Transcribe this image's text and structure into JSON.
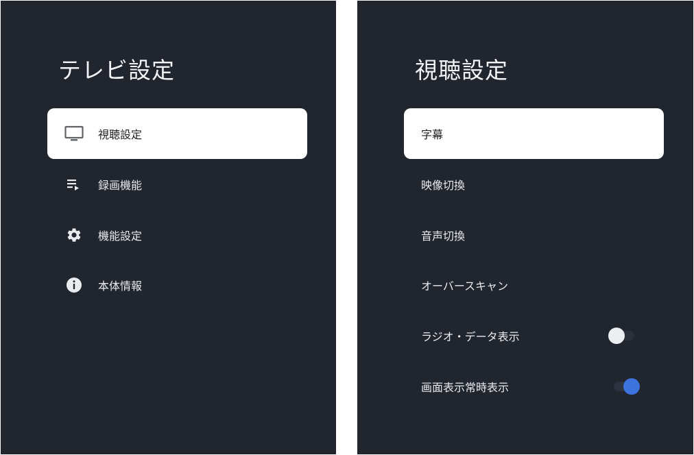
{
  "left_panel": {
    "title": "テレビ設定",
    "items": [
      {
        "label": "視聴設定",
        "icon": "tv-icon",
        "selected": true
      },
      {
        "label": "録画機能",
        "icon": "playlist-play-icon",
        "selected": false
      },
      {
        "label": "機能設定",
        "icon": "gear-icon",
        "selected": false
      },
      {
        "label": "本体情報",
        "icon": "info-icon",
        "selected": false
      }
    ]
  },
  "right_panel": {
    "title": "視聴設定",
    "items": [
      {
        "label": "字幕",
        "selected": true
      },
      {
        "label": "映像切換"
      },
      {
        "label": "音声切換"
      },
      {
        "label": "オーバースキャン"
      },
      {
        "label": "ラジオ・データ表示",
        "toggle": "off"
      },
      {
        "label": "画面表示常時表示",
        "toggle": "on"
      }
    ]
  },
  "colors": {
    "panel_bg": "#21252e",
    "selected_bg": "#ffffff",
    "toggle_on": "#3d73dc",
    "text": "#e9ebee"
  }
}
